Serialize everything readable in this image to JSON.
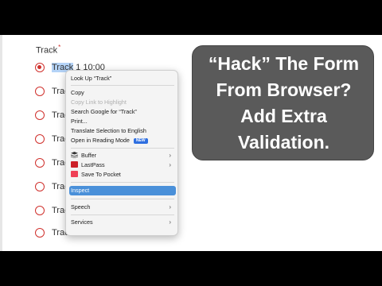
{
  "field": {
    "label": "Track",
    "required_mark": "*"
  },
  "options": [
    {
      "prefix": "Track",
      "suffix": " 1 10:00"
    },
    {
      "label": "Track"
    },
    {
      "label": "Track"
    },
    {
      "label": "Track"
    },
    {
      "label": "Track"
    },
    {
      "label": "Track"
    },
    {
      "label": "Track"
    },
    {
      "label": "Track 7 17:00"
    }
  ],
  "context_menu": {
    "look_up": "Look Up “Track”",
    "copy": "Copy",
    "copy_link": "Copy Link to Highlight",
    "search_google": "Search Google for “Track”",
    "print": "Print...",
    "translate": "Translate Selection to English",
    "reading_mode": "Open in Reading Mode",
    "new_badge": "NEW",
    "buffer": "Buffer",
    "lastpass": "LastPass",
    "pocket": "Save To Pocket",
    "inspect": "Inspect",
    "speech": "Speech",
    "services": "Services"
  },
  "overlay": {
    "line1": "“Hack” The Form",
    "line2": "From Browser?",
    "line3": "Add Extra",
    "line4": "Validation."
  },
  "colors": {
    "accent": "#d0312d",
    "selection": "#b4d3f7",
    "menu_highlight": "#4a90d9",
    "overlay_bg": "#5a5a5a"
  }
}
